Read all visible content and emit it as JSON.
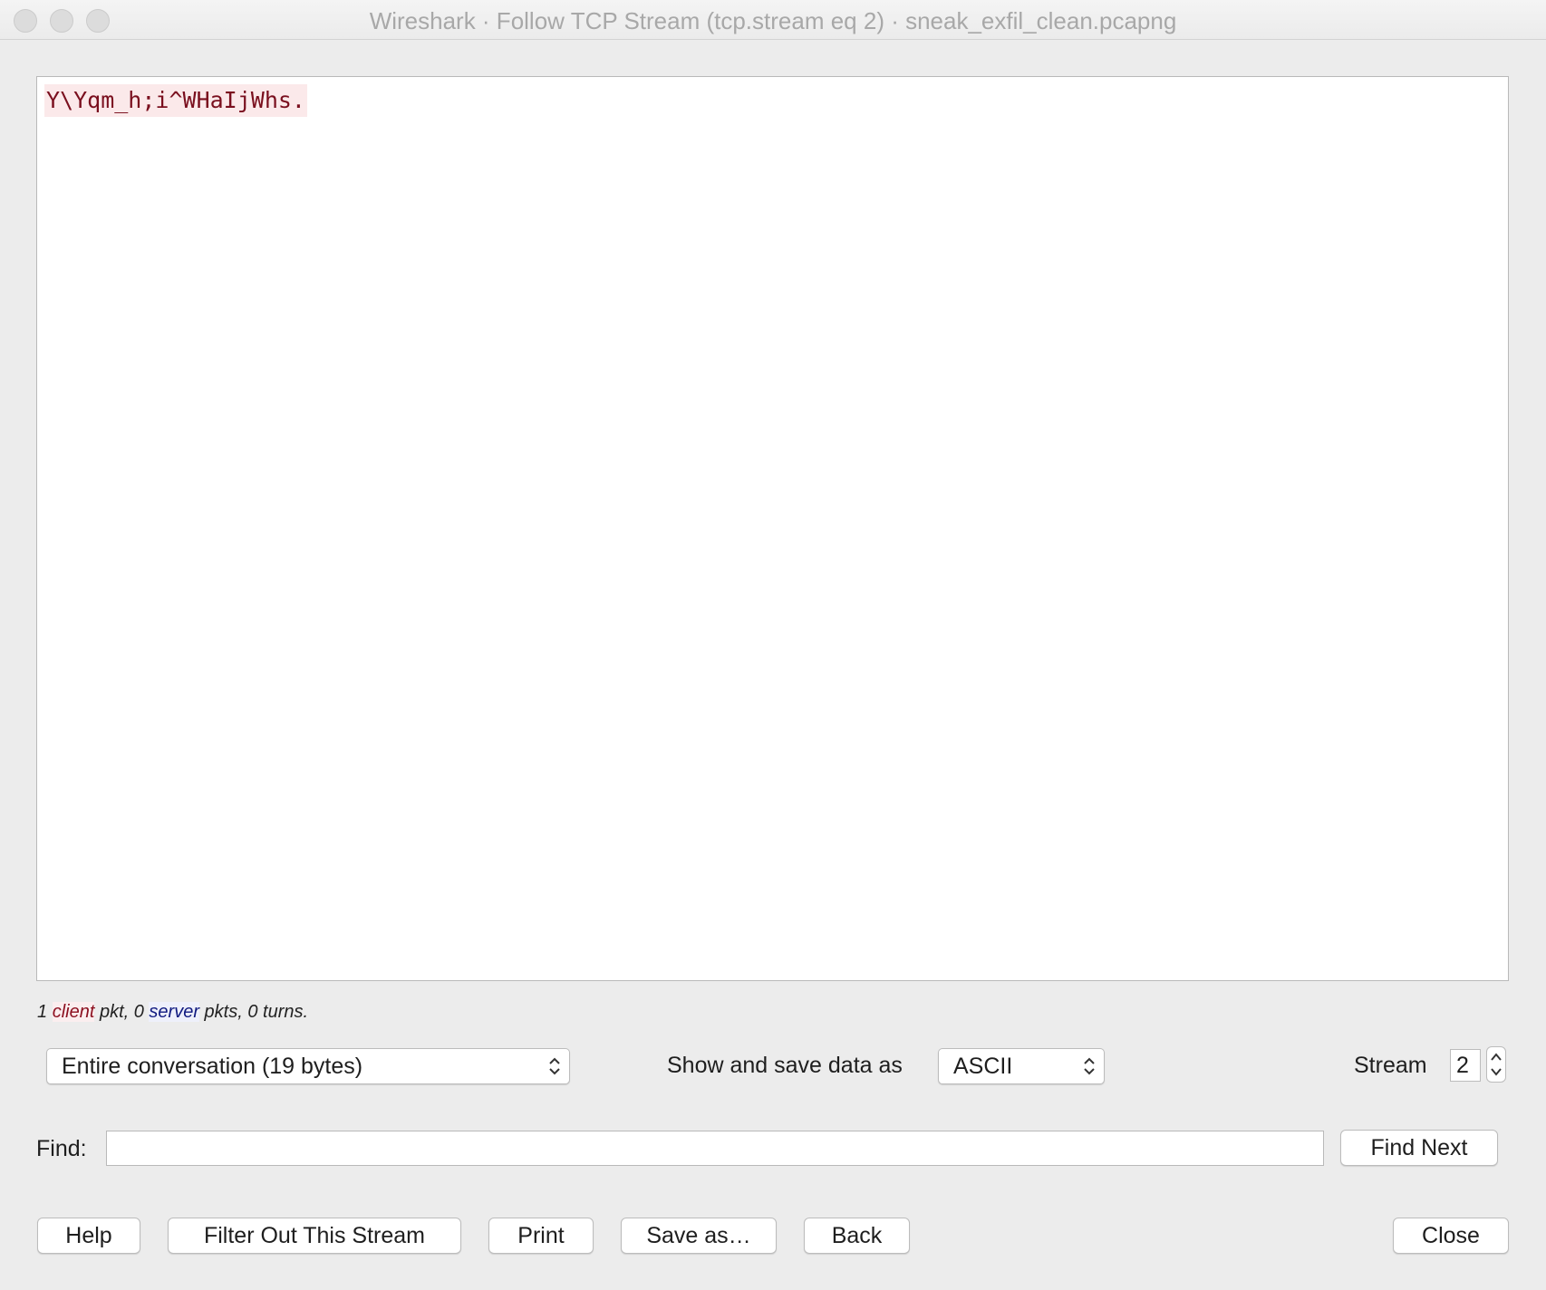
{
  "window": {
    "title": "Wireshark · Follow TCP Stream (tcp.stream eq 2) · sneak_exfil_clean.pcapng"
  },
  "stream_content": {
    "payload_text": "Y\\Yqm_h;i^WHaIjWhs.",
    "client_color": "#7a0f1e",
    "client_bg": "#fbe9ea"
  },
  "stats": {
    "client_count": "1",
    "client_word": "client",
    "client_rest": " pkt, 0 ",
    "server_word": "server",
    "server_rest": " pkts, 0 turns."
  },
  "controls": {
    "conversation_select": "Entire conversation (19 bytes)",
    "show_save_label": "Show and save data as",
    "format_select": "ASCII",
    "stream_label": "Stream",
    "stream_value": "2"
  },
  "find": {
    "label": "Find:",
    "value": "",
    "find_next_label": "Find Next"
  },
  "buttons": {
    "help": "Help",
    "filter_out": "Filter Out This Stream",
    "print": "Print",
    "save_as": "Save as…",
    "back": "Back",
    "close": "Close"
  }
}
